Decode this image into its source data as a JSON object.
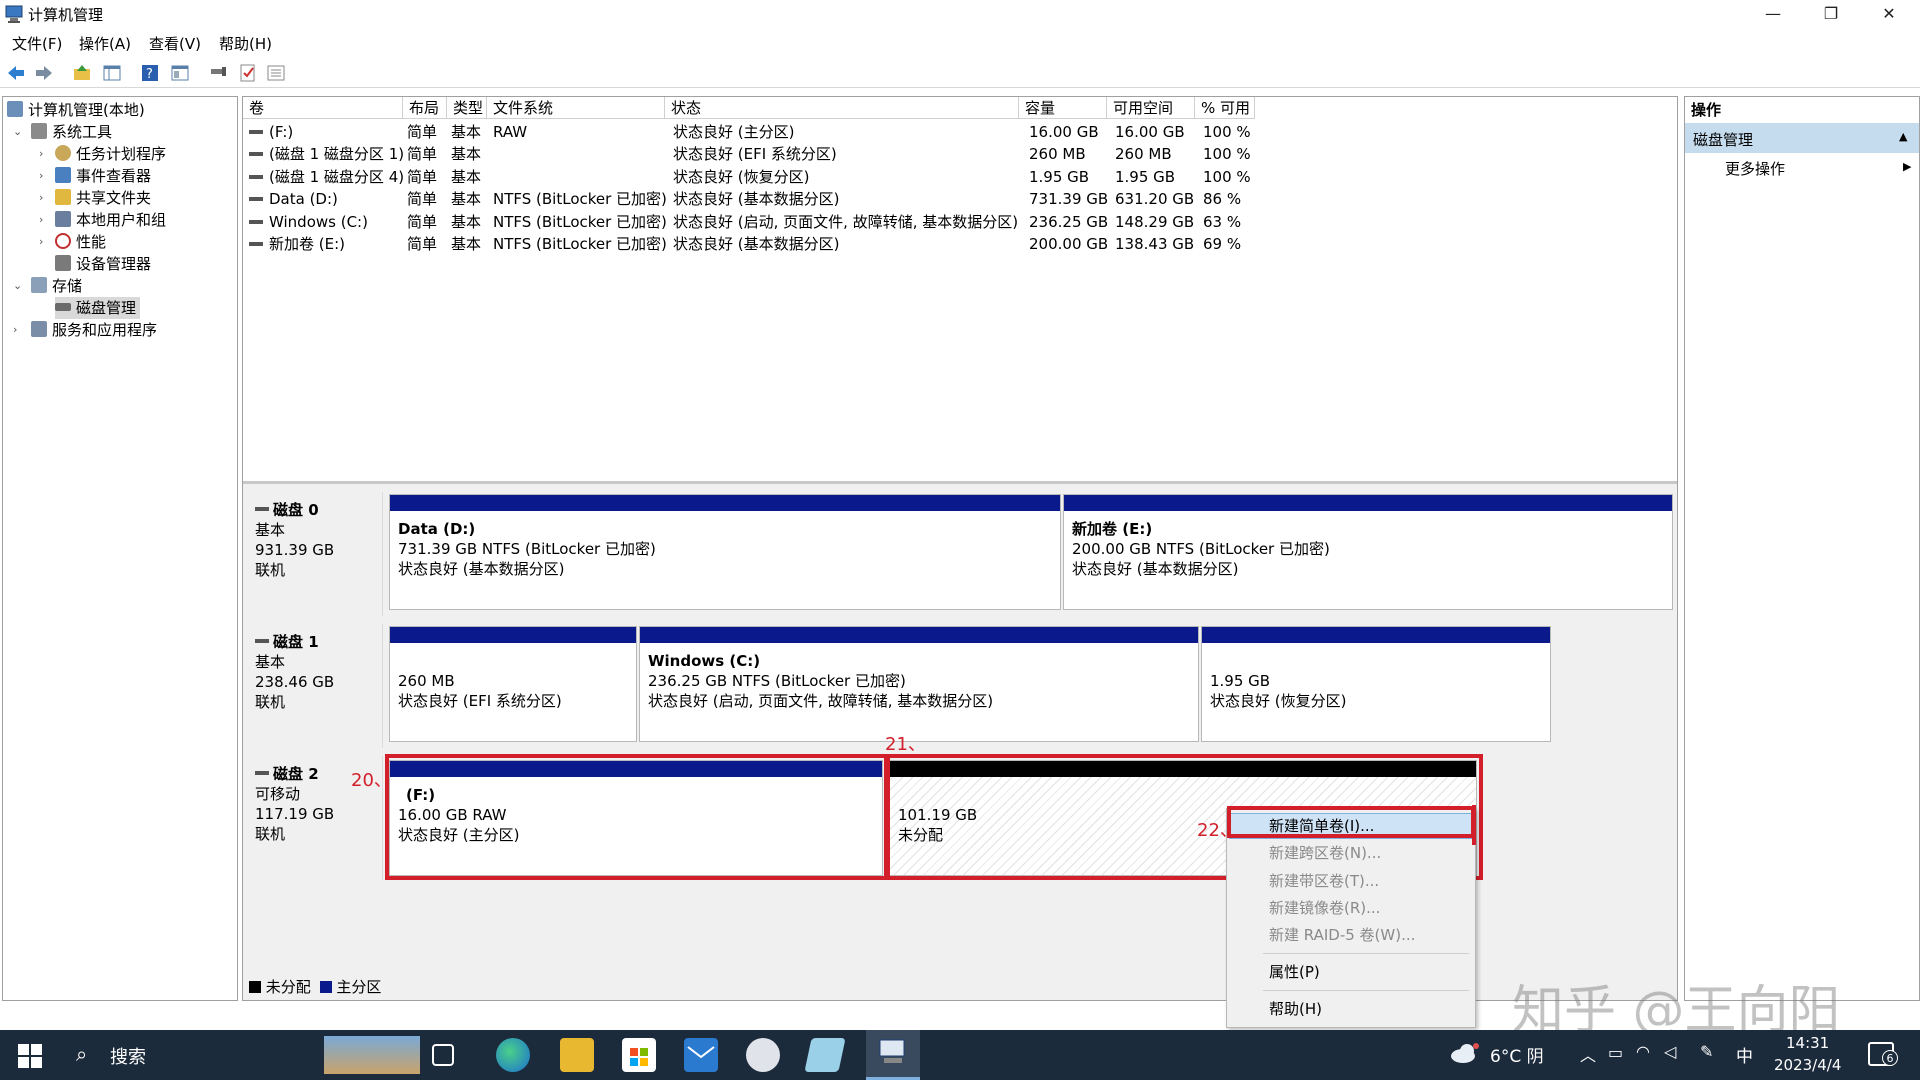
{
  "window": {
    "title": "计算机管理",
    "minimize_glyph": "—",
    "restore_glyph": "❐",
    "close_glyph": "✕"
  },
  "menu": [
    "文件(F)",
    "操作(A)",
    "查看(V)",
    "帮助(H)"
  ],
  "toolbar_icons": [
    "back-icon",
    "forward-icon",
    "up-folder-icon",
    "show-hide-tree-icon",
    "help-icon",
    "console-icon",
    "connect-icon",
    "checklist-icon",
    "properties-icon"
  ],
  "tree": {
    "root": "计算机管理(本地)",
    "system_tools": "系统工具",
    "task_scheduler": "任务计划程序",
    "event_viewer": "事件查看器",
    "shared_folders": "共享文件夹",
    "local_users": "本地用户和组",
    "performance": "性能",
    "device_manager": "设备管理器",
    "storage": "存储",
    "disk_management": "磁盘管理",
    "services_apps": "服务和应用程序"
  },
  "table": {
    "headers": [
      "卷",
      "布局",
      "类型",
      "文件系统",
      "状态",
      "容量",
      "可用空间",
      "% 可用"
    ],
    "rows": [
      [
        "(F:)",
        "简单",
        "基本",
        "RAW",
        "状态良好 (主分区)",
        "16.00 GB",
        "16.00 GB",
        "100 %"
      ],
      [
        "(磁盘 1 磁盘分区 1)",
        "简单",
        "基本",
        "",
        "状态良好 (EFI 系统分区)",
        "260 MB",
        "260 MB",
        "100 %"
      ],
      [
        "(磁盘 1 磁盘分区 4)",
        "简单",
        "基本",
        "",
        "状态良好 (恢复分区)",
        "1.95 GB",
        "1.95 GB",
        "100 %"
      ],
      [
        "Data (D:)",
        "简单",
        "基本",
        "NTFS (BitLocker 已加密)",
        "状态良好 (基本数据分区)",
        "731.39 GB",
        "631.20 GB",
        "86 %"
      ],
      [
        "Windows (C:)",
        "简单",
        "基本",
        "NTFS (BitLocker 已加密)",
        "状态良好 (启动, 页面文件, 故障转储, 基本数据分区)",
        "236.25 GB",
        "148.29 GB",
        "63 %"
      ],
      [
        "新加卷 (E:)",
        "简单",
        "基本",
        "NTFS (BitLocker 已加密)",
        "状态良好 (基本数据分区)",
        "200.00 GB",
        "138.43 GB",
        "69 %"
      ]
    ]
  },
  "disks": {
    "disk0": {
      "name": "磁盘 0",
      "type": "基本",
      "size": "931.39 GB",
      "status": "联机",
      "p1": {
        "title": "Data  (D:)",
        "info": "731.39 GB NTFS (BitLocker 已加密)",
        "status": "状态良好 (基本数据分区)"
      },
      "p2": {
        "title": "新加卷  (E:)",
        "info": "200.00 GB NTFS (BitLocker 已加密)",
        "status": "状态良好 (基本数据分区)"
      }
    },
    "disk1": {
      "name": "磁盘 1",
      "type": "基本",
      "size": "238.46 GB",
      "status": "联机",
      "p1": {
        "info": "260 MB",
        "status": "状态良好 (EFI 系统分区)"
      },
      "p2": {
        "title": "Windows  (C:)",
        "info": "236.25 GB NTFS (BitLocker 已加密)",
        "status": "状态良好 (启动, 页面文件, 故障转储, 基本数据分区)"
      },
      "p3": {
        "info": "1.95 GB",
        "status": "状态良好 (恢复分区)"
      }
    },
    "disk2": {
      "name": "磁盘 2",
      "type": "可移动",
      "size": "117.19 GB",
      "status": "联机",
      "p1": {
        "title": "(F:)",
        "info": "16.00 GB RAW",
        "status": "状态良好 (主分区)"
      },
      "p2": {
        "info": "101.19 GB",
        "status": "未分配"
      }
    }
  },
  "legend": {
    "unallocated": "未分配",
    "primary": "主分区"
  },
  "annotations": {
    "a20": "20、",
    "a21": "21、",
    "a22": "22、"
  },
  "actions": {
    "header": "操作",
    "section": "磁盘管理",
    "more": "更多操作",
    "collapse_glyph": "▲",
    "more_glyph": "▶"
  },
  "context_menu": {
    "new_simple": "新建简单卷(I)...",
    "new_spanned": "新建跨区卷(N)...",
    "new_striped": "新建带区卷(T)...",
    "new_mirrored": "新建镜像卷(R)...",
    "new_raid5": "新建 RAID-5 卷(W)...",
    "properties": "属性(P)",
    "help": "帮助(H)"
  },
  "watermark": "知乎 @王向阳",
  "taskbar": {
    "search": "搜索",
    "weather": "6°C 阴",
    "ime": "中",
    "time": "14:31",
    "date": "2023/4/4",
    "notifications": "6"
  },
  "colors": {
    "primary_partition": "#0a1a8c",
    "unallocated": "#000000",
    "highlight": "#cfe3f7",
    "annotation_red": "#d21f2a",
    "taskbar": "#1c2b3c",
    "actions_header": "#c5dbee"
  }
}
